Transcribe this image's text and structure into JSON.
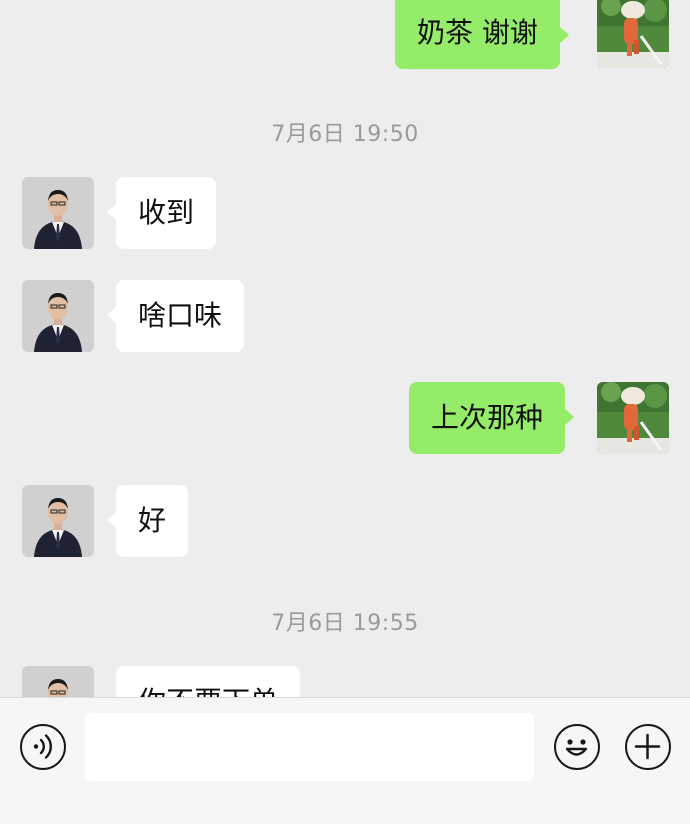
{
  "conversation": {
    "messages": [
      {
        "side": "out",
        "text": "奶茶  谢谢"
      },
      {
        "type": "time",
        "text": "7月6日 19:50"
      },
      {
        "side": "in",
        "text": "收到"
      },
      {
        "side": "in",
        "text": "啥口味"
      },
      {
        "side": "out",
        "text": "上次那种"
      },
      {
        "side": "in",
        "text": "好"
      },
      {
        "type": "time",
        "text": "7月6日 19:55"
      },
      {
        "side": "in",
        "text": "你不要下单"
      }
    ]
  },
  "input_bar": {
    "voice_icon": "voice-icon",
    "emoji_icon": "emoji-icon",
    "more_icon": "plus-icon",
    "input_value": ""
  },
  "colors": {
    "background": "#ededed",
    "outgoing_bubble": "#95ec69",
    "incoming_bubble": "#ffffff",
    "timestamp": "#9a9a9a"
  }
}
